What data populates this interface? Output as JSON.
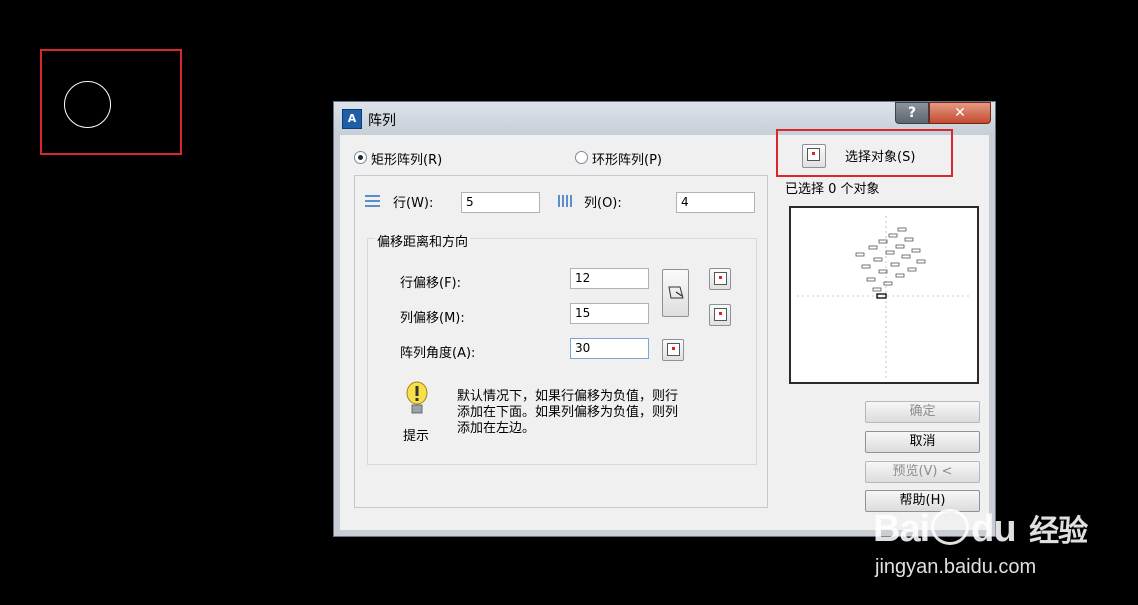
{
  "dialog": {
    "title": "阵列",
    "title_icon": "A",
    "help_glyph": "?",
    "close_glyph": "✕",
    "rect_array_label": "矩形阵列(R)",
    "polar_array_label": "环形阵列(P)",
    "rows_label": "行(W):",
    "rows_value": "5",
    "cols_label": "列(O):",
    "cols_value": "4",
    "offset_group_title": "偏移距离和方向",
    "row_offset_label": "行偏移(F):",
    "row_offset_value": "12",
    "col_offset_label": "列偏移(M):",
    "col_offset_value": "15",
    "angle_label": "阵列角度(A):",
    "angle_value": "30",
    "tip_text_1": "默认情况下，如果行偏移为负值，则行",
    "tip_text_2": "添加在下面。如果列偏移为负值，则列",
    "tip_text_3": "添加在左边。",
    "tip_label": "提示",
    "select_objects_label": "选择对象(S)",
    "selected_count_text": "已选择 0 个对象",
    "ok_label": "确定",
    "cancel_label": "取消",
    "preview_label": "预览(V) <",
    "help_label": "帮助(H)",
    "rect_selected": true
  },
  "watermark": {
    "brand_1": "Bai",
    "brand_2": "du",
    "brand_3": "经验",
    "url": "jingyan.baidu.com"
  },
  "colors": {
    "annotation_red": "#d9272e",
    "canvas": "#000000"
  }
}
